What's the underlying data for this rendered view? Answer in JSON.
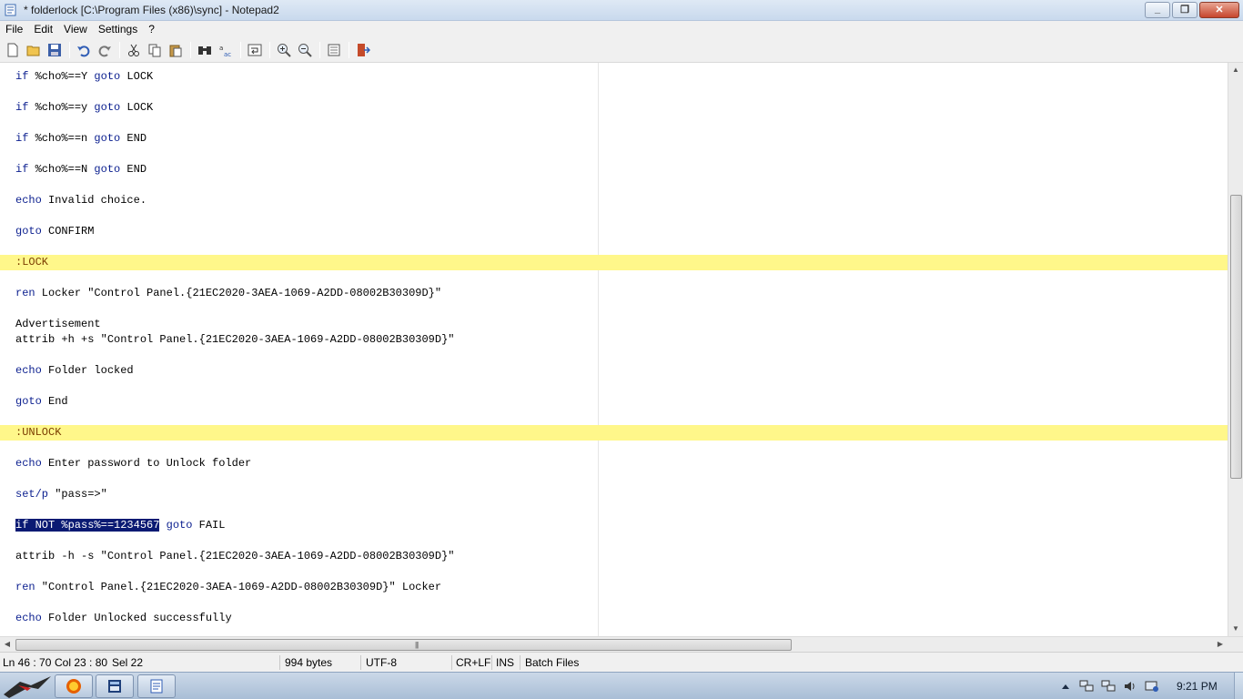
{
  "window": {
    "title": "* folderlock [C:\\Program Files (x86)\\sync] - Notepad2",
    "controls": [
      "minimize",
      "maximize",
      "close"
    ]
  },
  "menu": [
    "File",
    "Edit",
    "View",
    "Settings",
    "?"
  ],
  "toolbar": {
    "icons": [
      "new-file-icon",
      "open-file-icon",
      "save-icon",
      "undo-icon",
      "redo-icon",
      "cut-icon",
      "copy-icon",
      "paste-icon",
      "find-icon",
      "replace-icon",
      "word-wrap-icon",
      "zoom-in-icon",
      "zoom-out-icon",
      "settings-icon",
      "exit-icon"
    ]
  },
  "editor": {
    "lines": [
      {
        "kind": "code",
        "kw": "if",
        "text": " %cho%==Y ",
        "kw2": "goto",
        "text2": " LOCK"
      },
      {
        "kind": "code",
        "kw": "if",
        "text": " %cho%==y ",
        "kw2": "goto",
        "text2": " LOCK"
      },
      {
        "kind": "code",
        "kw": "if",
        "text": " %cho%==n ",
        "kw2": "goto",
        "text2": " END"
      },
      {
        "kind": "code",
        "kw": "if",
        "text": " %cho%==N ",
        "kw2": "goto",
        "text2": " END"
      },
      {
        "kind": "code",
        "kw": "echo",
        "text": " Invalid choice."
      },
      {
        "kind": "code",
        "kw": "goto",
        "text": " CONFIRM"
      },
      {
        "kind": "label",
        "text": ":LOCK"
      },
      {
        "kind": "code",
        "kw": "ren",
        "text": " Locker \"Control Panel.{21EC2020-3AEA-1069-A2DD-08002B30309D}\""
      },
      {
        "kind": "plain",
        "text": "Advertisement"
      },
      {
        "kind": "code",
        "kw": "",
        "text": "attrib +h +s \"Control Panel.{21EC2020-3AEA-1069-A2DD-08002B30309D}\""
      },
      {
        "kind": "code",
        "kw": "echo",
        "text": " Folder locked"
      },
      {
        "kind": "code",
        "kw": "goto",
        "text": " End"
      },
      {
        "kind": "label",
        "text": ":UNLOCK"
      },
      {
        "kind": "code",
        "kw": "echo",
        "text": " Enter password to Unlock folder"
      },
      {
        "kind": "code",
        "kw": "set/p",
        "text": " \"pass=>\""
      },
      {
        "kind": "selected",
        "sel": "if NOT %pass%==1234567",
        "kw2": " goto",
        "text2": " FAIL"
      },
      {
        "kind": "code",
        "kw": "",
        "text": "attrib -h -s \"Control Panel.{21EC2020-3AEA-1069-A2DD-08002B30309D}\""
      },
      {
        "kind": "code",
        "kw": "ren",
        "text": " \"Control Panel.{21EC2020-3AEA-1069-A2DD-08002B30309D}\" Locker"
      },
      {
        "kind": "code",
        "kw": "echo",
        "text": " Folder Unlocked successfully"
      }
    ]
  },
  "status": {
    "position": "Ln 46 : 70",
    "column": "Col 23 : 80",
    "selection": "Sel 22",
    "size": "994 bytes",
    "encoding": "UTF-8",
    "line_endings": "CR+LF",
    "mode": "INS",
    "scheme": "Batch Files"
  },
  "taskbar": {
    "clock": "9:21 PM",
    "buttons": [
      "firefox-icon",
      "explorer-icon",
      "notepad-icon"
    ]
  },
  "colors": {
    "keyword": "#0b1f8f",
    "label_bg": "#fff78a",
    "selection_bg": "#0a1a73"
  }
}
